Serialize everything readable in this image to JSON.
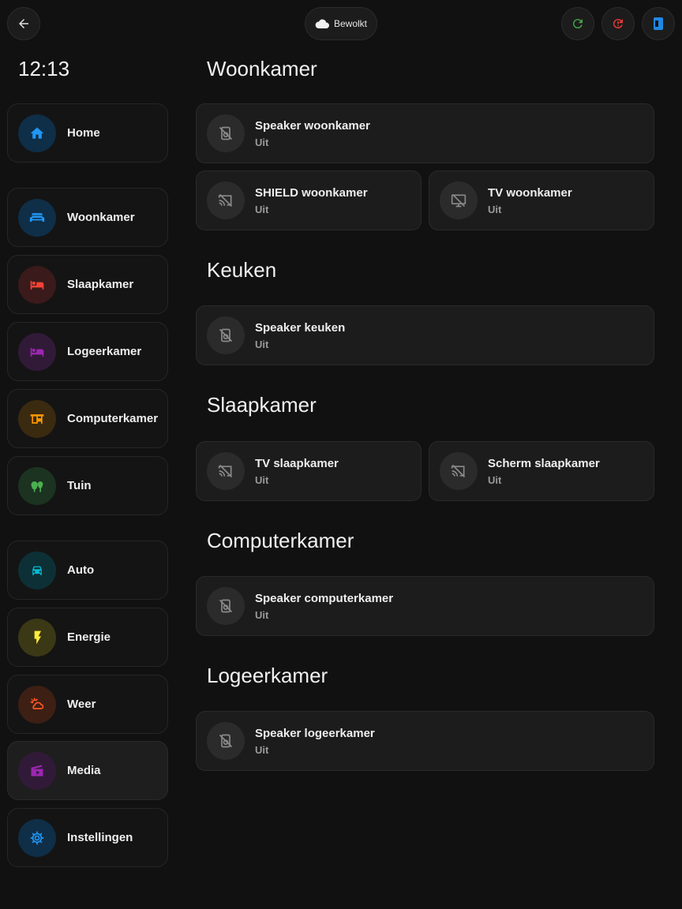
{
  "header": {
    "weather_label": "Bewolkt"
  },
  "clock": "12:13",
  "colors": {
    "refresh": "#43a047",
    "alert": "#e53935",
    "tablet": "#1e88e5"
  },
  "nav": [
    {
      "label": "Home",
      "icon": "home-icon",
      "color": "#2196f3"
    },
    {
      "label": "Woonkamer",
      "icon": "sofa-icon",
      "color": "#2196f3"
    },
    {
      "label": "Slaapkamer",
      "icon": "bed-icon",
      "color": "#f44336"
    },
    {
      "label": "Logeerkamer",
      "icon": "bed-icon",
      "color": "#9c27b0"
    },
    {
      "label": "Computerkamer",
      "icon": "desk-icon",
      "color": "#ff9800"
    },
    {
      "label": "Tuin",
      "icon": "tree-icon",
      "color": "#4caf50"
    },
    {
      "label": "Auto",
      "icon": "car-icon",
      "color": "#00bcd4"
    },
    {
      "label": "Energie",
      "icon": "flash-icon",
      "color": "#ffeb3b"
    },
    {
      "label": "Weer",
      "icon": "weather-icon",
      "color": "#ff5722"
    },
    {
      "label": "Media",
      "icon": "media-icon",
      "color": "#9c27b0"
    },
    {
      "label": "Instellingen",
      "icon": "gear-icon",
      "color": "#2196f3"
    }
  ],
  "sections": [
    {
      "title": "Woonkamer",
      "devices": [
        {
          "name": "Speaker woonkamer",
          "state": "Uit",
          "icon": "speaker-off-icon"
        },
        {
          "name": "SHIELD woonkamer",
          "state": "Uit",
          "icon": "cast-off-icon"
        },
        {
          "name": "TV woonkamer",
          "state": "Uit",
          "icon": "monitor-off-icon"
        }
      ]
    },
    {
      "title": "Keuken",
      "devices": [
        {
          "name": "Speaker keuken",
          "state": "Uit",
          "icon": "speaker-off-icon"
        }
      ]
    },
    {
      "title": "Slaapkamer",
      "devices": [
        {
          "name": "TV slaapkamer",
          "state": "Uit",
          "icon": "cast-off-icon"
        },
        {
          "name": "Scherm slaapkamer",
          "state": "Uit",
          "icon": "cast-off-icon"
        }
      ]
    },
    {
      "title": "Computerkamer",
      "devices": [
        {
          "name": "Speaker computerkamer",
          "state": "Uit",
          "icon": "speaker-off-icon"
        }
      ]
    },
    {
      "title": "Logeerkamer",
      "devices": [
        {
          "name": "Speaker logeerkamer",
          "state": "Uit",
          "icon": "speaker-off-icon"
        }
      ]
    }
  ]
}
